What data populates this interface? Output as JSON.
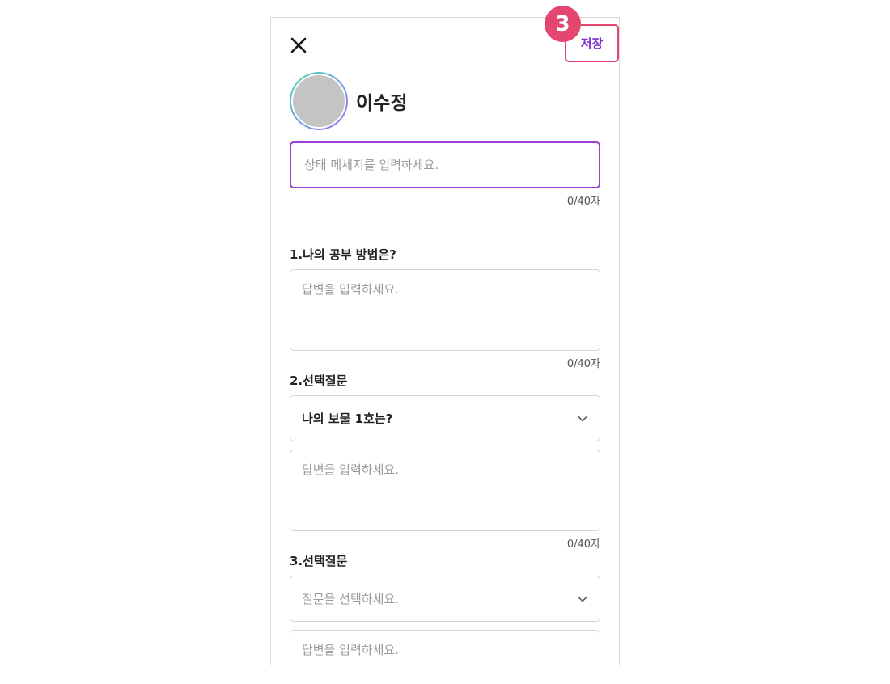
{
  "header": {
    "save_label": "저장",
    "step_badge": "3"
  },
  "profile": {
    "name": "이수정"
  },
  "status": {
    "placeholder": "상태 메세지를 입력하세요.",
    "value": "",
    "counter": "0/40자"
  },
  "questions": [
    {
      "label": "1.나의 공부 방법은?",
      "answer_placeholder": "답변을 입력하세요.",
      "answer_value": "",
      "counter": "0/40자"
    },
    {
      "label": "2.선택질문",
      "selected_question": "나의 보물 1호는?",
      "answer_placeholder": "답변을 입력하세요.",
      "answer_value": "",
      "counter": "0/40자"
    },
    {
      "label": "3.선택질문",
      "select_placeholder": "질문을 선택하세요.",
      "answer_placeholder": "답변을 입력하세요.",
      "answer_value": ""
    }
  ],
  "colors": {
    "accent_purple": "#9b3fd6",
    "badge_pink": "#e3476f",
    "save_text": "#7b2fd4"
  },
  "icons": {
    "close": "close-icon",
    "dropdown": "chevron-down-icon"
  }
}
